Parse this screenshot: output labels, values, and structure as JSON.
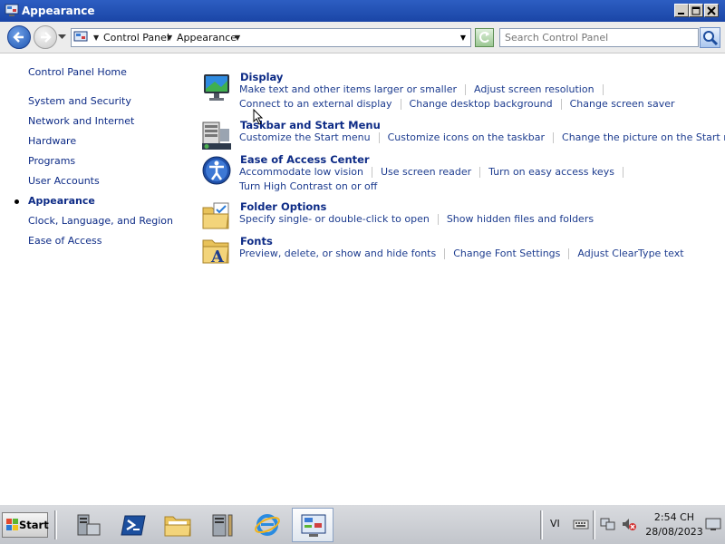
{
  "window": {
    "title": "Appearance"
  },
  "address": {
    "crumbs": [
      "Control Panel",
      "Appearance"
    ],
    "search_placeholder": "Search Control Panel"
  },
  "leftnav": {
    "items": [
      {
        "label": "Control Panel Home",
        "current": false
      },
      {
        "label": "System and Security",
        "current": false
      },
      {
        "label": "Network and Internet",
        "current": false
      },
      {
        "label": "Hardware",
        "current": false
      },
      {
        "label": "Programs",
        "current": false
      },
      {
        "label": "User Accounts",
        "current": false
      },
      {
        "label": "Appearance",
        "current": true
      },
      {
        "label": "Clock, Language, and Region",
        "current": false
      },
      {
        "label": "Ease of Access",
        "current": false
      }
    ]
  },
  "categories": [
    {
      "title": "Display",
      "icon": "display-icon",
      "lines": [
        [
          "Make text and other items larger or smaller",
          "Adjust screen resolution"
        ],
        [
          "Connect to an external display",
          "Change desktop background",
          "Change screen saver"
        ]
      ]
    },
    {
      "title": "Taskbar and Start Menu",
      "icon": "taskbar-icon",
      "lines": [
        [
          "Customize the Start menu",
          "Customize icons on the taskbar",
          "Change the picture on the Start menu"
        ]
      ]
    },
    {
      "title": "Ease of Access Center",
      "icon": "ease-of-access-icon",
      "lines": [
        [
          "Accommodate low vision",
          "Use screen reader",
          "Turn on easy access keys"
        ],
        [
          "Turn High Contrast on or off"
        ]
      ]
    },
    {
      "title": "Folder Options",
      "icon": "folder-options-icon",
      "lines": [
        [
          "Specify single- or double-click to open",
          "Show hidden files and folders"
        ]
      ]
    },
    {
      "title": "Fonts",
      "icon": "fonts-icon",
      "lines": [
        [
          "Preview, delete, or show and hide fonts",
          "Change Font Settings",
          "Adjust ClearType text"
        ]
      ]
    }
  ],
  "taskbar": {
    "start_label": "Start",
    "language": "VI",
    "clock_time": "2:54 CH",
    "clock_date": "28/08/2023"
  },
  "colors": {
    "titlebar": "#1a45a6",
    "link": "#0d2b86",
    "taskbar": "#c9ccd1"
  }
}
